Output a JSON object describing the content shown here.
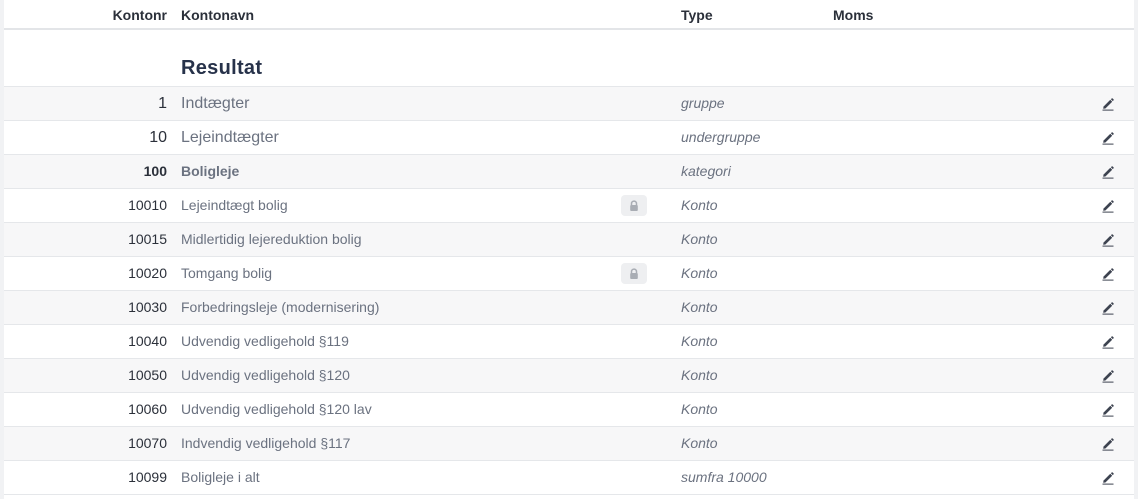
{
  "table": {
    "headers": {
      "nr": "Kontonr",
      "name": "Kontonavn",
      "type": "Type",
      "moms": "Moms"
    },
    "section_title": "Resultat",
    "rows": [
      {
        "nr": "1",
        "name": "Indtægter",
        "type": "gruppe",
        "locked": false,
        "style": "big"
      },
      {
        "nr": "10",
        "name": "Lejeindtægter",
        "type": "undergruppe",
        "locked": false,
        "style": "big"
      },
      {
        "nr": "100",
        "name": "Boligleje",
        "type": "kategori",
        "locked": false,
        "style": "bold"
      },
      {
        "nr": "10010",
        "name": "Lejeindtægt bolig",
        "type": "Konto",
        "locked": true,
        "style": ""
      },
      {
        "nr": "10015",
        "name": "Midlertidig lejereduktion bolig",
        "type": "Konto",
        "locked": false,
        "style": ""
      },
      {
        "nr": "10020",
        "name": "Tomgang bolig",
        "type": "Konto",
        "locked": true,
        "style": ""
      },
      {
        "nr": "10030",
        "name": "Forbedringsleje (modernisering)",
        "type": "Konto",
        "locked": false,
        "style": ""
      },
      {
        "nr": "10040",
        "name": "Udvendig vedligehold §119",
        "type": "Konto",
        "locked": false,
        "style": ""
      },
      {
        "nr": "10050",
        "name": "Udvendig vedligehold §120",
        "type": "Konto",
        "locked": false,
        "style": ""
      },
      {
        "nr": "10060",
        "name": "Udvendig vedligehold §120 lav",
        "type": "Konto",
        "locked": false,
        "style": ""
      },
      {
        "nr": "10070",
        "name": "Indvendig vedligehold §117",
        "type": "Konto",
        "locked": false,
        "style": ""
      },
      {
        "nr": "10099",
        "name": "Boligleje i alt",
        "type": "sumfra 10000",
        "locked": false,
        "style": ""
      }
    ]
  },
  "icons": {
    "lock": "lock-icon",
    "edit": "pencil-icon"
  },
  "colors": {
    "heading": "#27324a",
    "row_alt": "#f7f7f8",
    "border": "#e5e7ea",
    "text_muted": "#6b7280"
  }
}
